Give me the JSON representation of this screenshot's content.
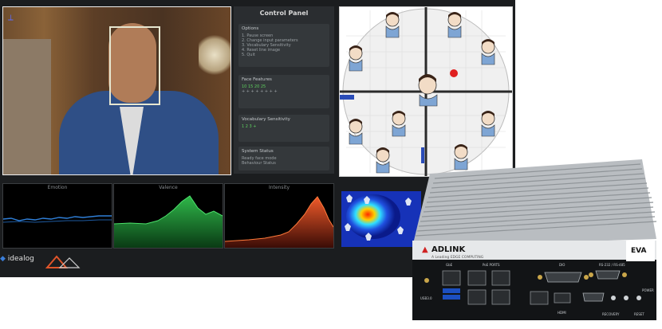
{
  "control_panel": {
    "title": "Control Panel",
    "sections": [
      {
        "head": "Options",
        "rows": [
          "1. Pause screen",
          "2. Change input parameters",
          "3. Vocabulary Sensitivity",
          "4. Reset line image",
          "5. Quit"
        ]
      },
      {
        "head": "Face Features",
        "rows": [
          "10  15  20  25",
          "+ + + + + + + +"
        ]
      },
      {
        "head": "Vocabulary Sensitivity",
        "rows": [
          "1  2  3  +"
        ]
      },
      {
        "head": "System Status",
        "rows": [
          "Ready face mode",
          "Behaviour    Status"
        ]
      }
    ]
  },
  "graphs": [
    {
      "label": "Emotion",
      "color": "#2f7fd8"
    },
    {
      "label": "Valence",
      "color": "#2fb84a"
    },
    {
      "label": "Intensity",
      "color": "#e2502a"
    }
  ],
  "logos": {
    "logo1": "idealog",
    "logo2": "ADLINK"
  },
  "device": {
    "brand": "ADLINK",
    "tagline": "A Leading EDGE COMPUTING",
    "model": "EVA",
    "port_labels": [
      "GbE",
      "PoE PORTS",
      "DIO",
      "RS-232 / RS-485",
      "POWER",
      "USB3.0",
      "HDMI",
      "RECOVERY",
      "RESET"
    ]
  }
}
